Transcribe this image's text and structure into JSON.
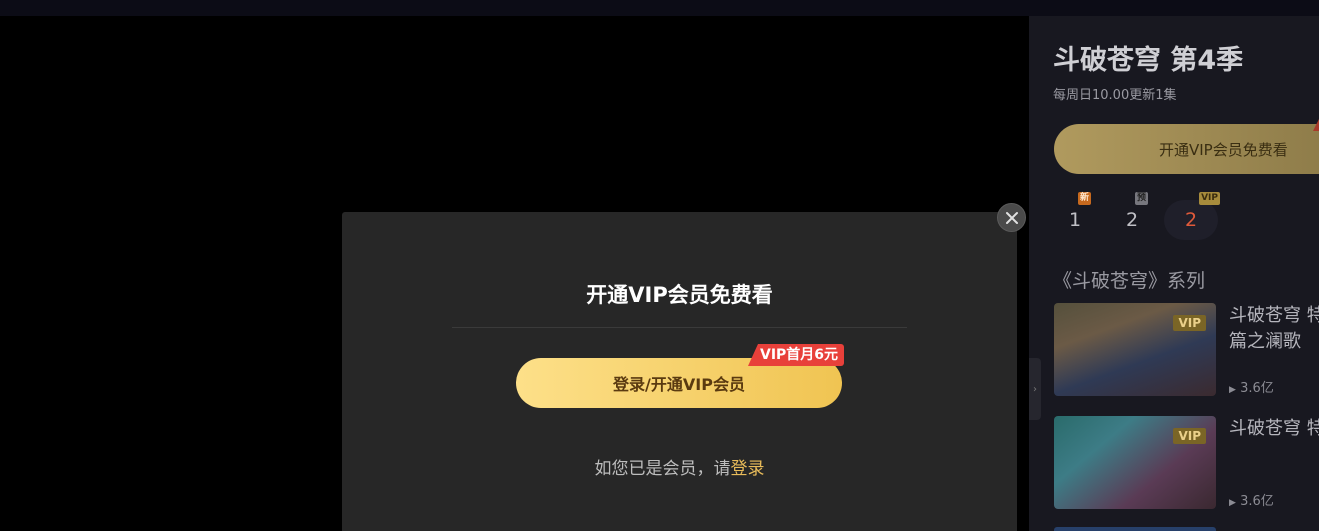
{
  "modal": {
    "title": "开通VIP会员免费看",
    "button_label": "登录/开通VIP会员",
    "promo_badge": "VIP首月6元",
    "login_prompt": "如您已是会员，请",
    "login_link": "登录"
  },
  "panel": {
    "title": "斗破苍穹 第4季",
    "update_schedule": "每周日10.00更新1集",
    "vip_button": "开通VIP会员免费看",
    "episodes": [
      {
        "number": "1",
        "tag": "新"
      },
      {
        "number": "2",
        "tag": "预"
      },
      {
        "number": "2",
        "tag": "VIP",
        "selected": true
      }
    ],
    "series_heading": "《斗破苍穹》系列",
    "cards": [
      {
        "title": "斗破苍穹 特别篇之澜歌",
        "tag": "VIP",
        "views": "3.6亿"
      },
      {
        "title": "斗破苍穹 特",
        "tag": "VIP",
        "views": "3.6亿"
      }
    ]
  },
  "colors": {
    "gold_accent": "#e9bc5a",
    "promo_red": "#e8403a",
    "active_episode": "#e05a3a"
  }
}
